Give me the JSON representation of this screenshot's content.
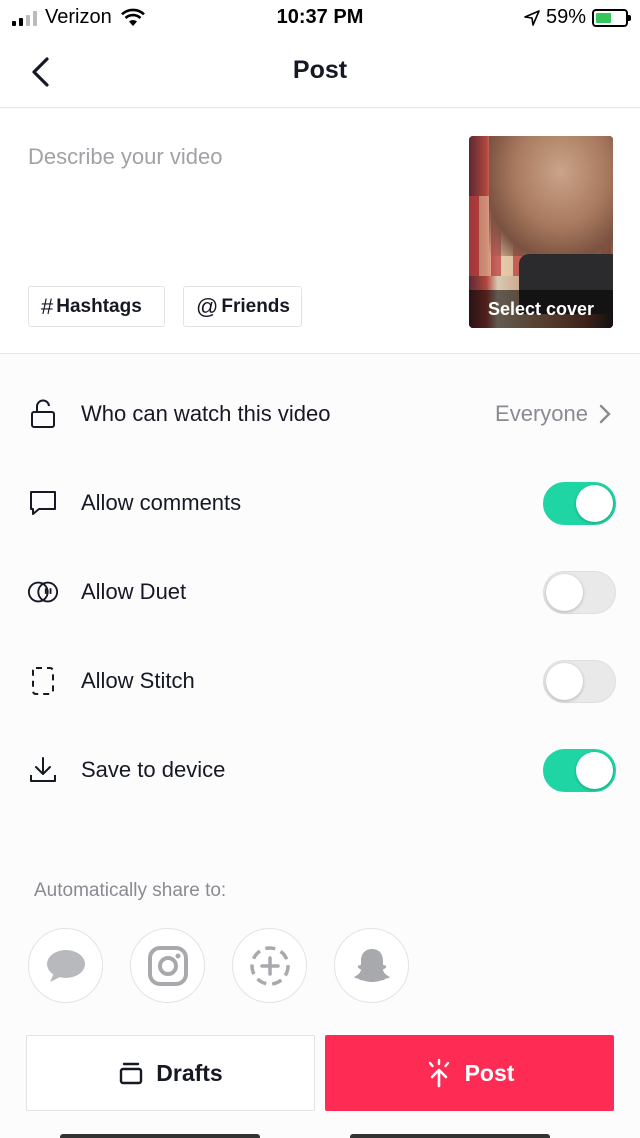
{
  "status_bar": {
    "carrier": "Verizon",
    "time": "10:37 PM",
    "battery": "59%"
  },
  "nav": {
    "title": "Post"
  },
  "description": {
    "placeholder": "Describe your video",
    "hashtags_label": "Hashtags",
    "friends_label": "Friends",
    "cover_label": "Select cover"
  },
  "settings": {
    "who_can_watch": {
      "label": "Who can watch this video",
      "value": "Everyone"
    },
    "allow_comments": {
      "label": "Allow comments",
      "on": true
    },
    "allow_duet": {
      "label": "Allow Duet",
      "on": false
    },
    "allow_stitch": {
      "label": "Allow Stitch",
      "on": false
    },
    "save_to_device": {
      "label": "Save to device",
      "on": true
    }
  },
  "share": {
    "title": "Automatically share to:",
    "targets": [
      "messages-icon",
      "instagram-icon",
      "status-add-icon",
      "snapchat-icon"
    ]
  },
  "actions": {
    "drafts_label": "Drafts",
    "post_label": "Post"
  },
  "colors": {
    "accent_post": "#fe2c55",
    "toggle_on": "#20d5a4"
  }
}
